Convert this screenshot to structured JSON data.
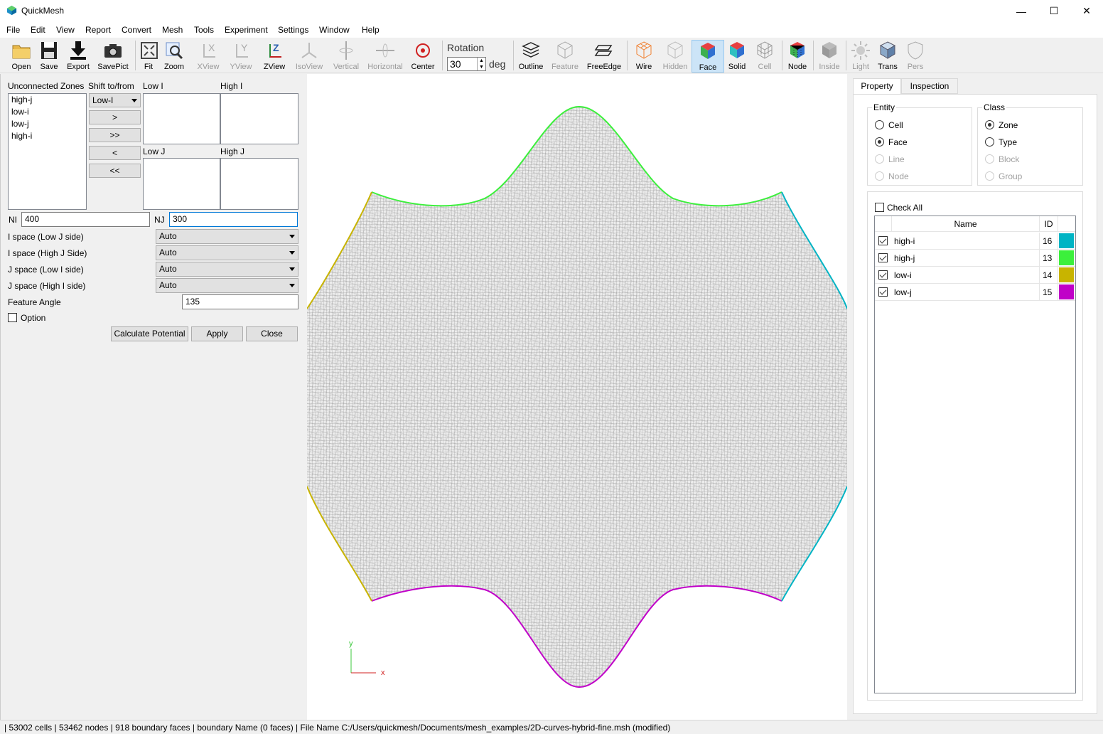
{
  "window": {
    "title": "QuickMesh",
    "minimize": "—",
    "maximize": "☐",
    "close": "✕"
  },
  "menu": [
    "File",
    "Edit",
    "View",
    "Report",
    "Convert",
    "Mesh",
    "Tools",
    "Experiment",
    "Settings",
    "Window",
    "Help"
  ],
  "toolbar": {
    "open": "Open",
    "save": "Save",
    "export": "Export",
    "savepict": "SavePict",
    "fit": "Fit",
    "zoom": "Zoom",
    "xview": "XView",
    "yview": "YView",
    "zview": "ZView",
    "isoview": "IsoView",
    "vertical": "Vertical",
    "horizontal": "Horizontal",
    "center": "Center",
    "rotation_label": "Rotation",
    "rotation_value": "30",
    "rotation_unit": "deg",
    "outline": "Outline",
    "feature": "Feature",
    "freeedge": "FreeEdge",
    "wire": "Wire",
    "hidden": "Hidden",
    "face": "Face",
    "solid": "Solid",
    "cell": "Cell",
    "node": "Node",
    "inside": "Inside",
    "light": "Light",
    "trans": "Trans",
    "pers": "Pers"
  },
  "left": {
    "unconnected_label": "Unconnected Zones",
    "shift_label": "Shift to/from",
    "zones": [
      "high-j",
      "low-i",
      "low-j",
      "high-i"
    ],
    "shift_combo": "Low-I",
    "btn_right": ">",
    "btn_right_all": ">>",
    "btn_left": "<",
    "btn_left_all": "<<",
    "low_i": "Low I",
    "high_i": "High I",
    "low_j": "Low J",
    "high_j": "High J",
    "ni_label": "NI",
    "ni_value": "400",
    "nj_label": "NJ",
    "nj_value": "300",
    "i_low_label": "I space (Low J side)",
    "i_low_value": "Auto",
    "i_high_label": "I space (High J Side)",
    "i_high_value": "Auto",
    "j_low_label": "J space (Low I side)",
    "j_low_value": "Auto",
    "j_high_label": "J space (High I side)",
    "j_high_value": "Auto",
    "feature_angle_label": "Feature Angle",
    "feature_angle_value": "135",
    "option_label": "Option",
    "calc_button": "Calculate Potential",
    "apply_button": "Apply",
    "close_button": "Close"
  },
  "viewport": {
    "axis_y": "y",
    "axis_x": "x"
  },
  "right": {
    "tab_property": "Property",
    "tab_inspection": "Inspection",
    "entity_title": "Entity",
    "entity_options": [
      "Cell",
      "Face",
      "Line",
      "Node"
    ],
    "class_title": "Class",
    "class_options": [
      "Zone",
      "Type",
      "Block",
      "Group"
    ],
    "check_all": "Check All",
    "col_name": "Name",
    "col_id": "ID",
    "rows": [
      {
        "name": "high-i",
        "id": "16",
        "color": "#00b4c4"
      },
      {
        "name": "high-j",
        "id": "13",
        "color": "#3cf03c"
      },
      {
        "name": "low-i",
        "id": "14",
        "color": "#c8b400"
      },
      {
        "name": "low-j",
        "id": "15",
        "color": "#c000c8"
      }
    ]
  },
  "status": "| 53002 cells | 53462 nodes | 918 boundary faces |  boundary Name  (0 faces) | File Name C:/Users/quickmesh/Documents/mesh_examples/2D-curves-hybrid-fine.msh (modified)"
}
